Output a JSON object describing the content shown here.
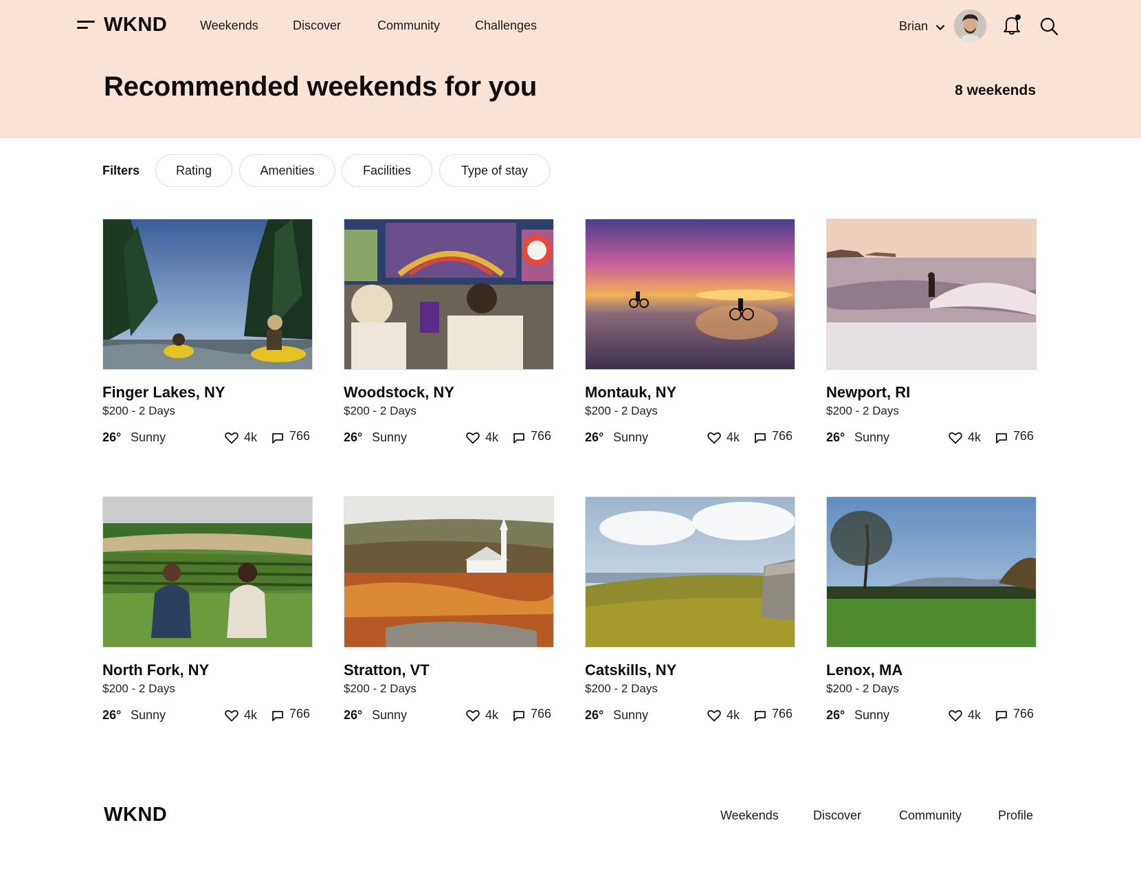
{
  "header": {
    "logo": "WKND",
    "nav": [
      "Weekends",
      "Discover",
      "Community",
      "Challenges"
    ],
    "user_name": "Brian",
    "icons": [
      "menu-icon",
      "chevron-down-icon",
      "avatar",
      "bell-icon",
      "search-icon"
    ]
  },
  "hero": {
    "title": "Recommended weekends for you",
    "count": "8 weekends"
  },
  "filters": {
    "label": "Filters",
    "pills": [
      "Rating",
      "Amenities",
      "Facilities",
      "Type of stay"
    ]
  },
  "cards": [
    {
      "title": "Finger Lakes, NY",
      "price": "$200 - 2 Days",
      "temp": "26°",
      "weather": "Sunny",
      "likes": "4k",
      "comments": "766"
    },
    {
      "title": "Woodstock, NY",
      "price": "$200 - 2 Days",
      "temp": "26°",
      "weather": "Sunny",
      "likes": "4k",
      "comments": "766"
    },
    {
      "title": "Montauk, NY",
      "price": "$200 - 2 Days",
      "temp": "26°",
      "weather": "Sunny",
      "likes": "4k",
      "comments": "766"
    },
    {
      "title": "Newport, RI",
      "price": "$200 - 2 Days",
      "temp": "26°",
      "weather": "Sunny",
      "likes": "4k",
      "comments": "766"
    },
    {
      "title": "North Fork, NY",
      "price": "$200 - 2 Days",
      "temp": "26°",
      "weather": "Sunny",
      "likes": "4k",
      "comments": "766"
    },
    {
      "title": "Stratton, VT",
      "price": "$200 - 2 Days",
      "temp": "26°",
      "weather": "Sunny",
      "likes": "4k",
      "comments": "766"
    },
    {
      "title": "Catskills, NY",
      "price": "$200 - 2 Days",
      "temp": "26°",
      "weather": "Sunny",
      "likes": "4k",
      "comments": "766"
    },
    {
      "title": "Lenox, MA",
      "price": "$200 - 2 Days",
      "temp": "26°",
      "weather": "Sunny",
      "likes": "4k",
      "comments": "766"
    }
  ],
  "footer": {
    "logo": "WKND",
    "links": [
      "Weekends",
      "Discover",
      "Community",
      "Profile"
    ]
  },
  "colors": {
    "hero_bg": "#f9e3d7",
    "text": "#111111",
    "pill_border": "#dcdcdc"
  }
}
